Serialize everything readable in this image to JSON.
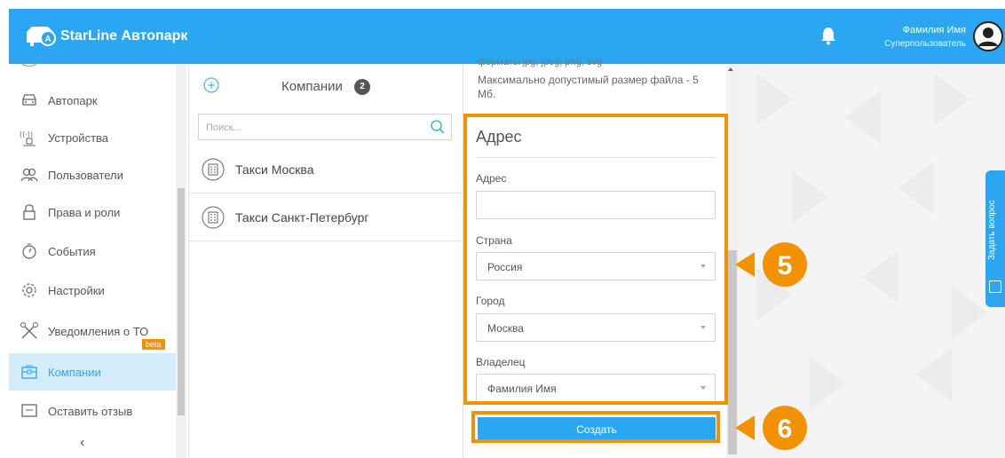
{
  "header": {
    "app_title": "StarLine Автопарк",
    "user_name": "Фамилия Имя",
    "user_role": "Суперпользователь"
  },
  "sidebar": {
    "items": [
      {
        "label": "Автопарк",
        "icon": "car-icon"
      },
      {
        "label": "Устройства",
        "icon": "device-icon"
      },
      {
        "label": "Пользователи",
        "icon": "users-icon"
      },
      {
        "label": "Права и роли",
        "icon": "lock-icon"
      },
      {
        "label": "События",
        "icon": "events-icon"
      },
      {
        "label": "Настройки",
        "icon": "gear-icon"
      },
      {
        "label": "Уведомления о ТО",
        "icon": "tools-icon"
      },
      {
        "label": "Компании",
        "icon": "company-icon"
      },
      {
        "label": "Оставить отзыв",
        "icon": "feedback-icon"
      }
    ],
    "beta_badge": "beta",
    "collapse_label": "‹"
  },
  "companies": {
    "title": "Компании",
    "count": "2",
    "search_placeholder": "Поиск...",
    "items": [
      {
        "label": "Такси Москва"
      },
      {
        "label": "Такси Санкт-Петербург"
      }
    ]
  },
  "form": {
    "file_hint_cut": "форматы jpg, jpeg, png, svg",
    "file_hint": "Максимально допустимый размер файла - 5 Мб.",
    "address_section_title": "Адрес",
    "address_label": "Адрес",
    "address_value": "",
    "country_label": "Страна",
    "country_value": "Россия",
    "city_label": "Город",
    "city_value": "Москва",
    "owner_label": "Владелец",
    "owner_value": "Фамилия Имя",
    "create_label": "Создать"
  },
  "markers": {
    "step_5": "5",
    "step_6": "6"
  },
  "ask_question": {
    "label": "Задать вопрос"
  },
  "colors": {
    "header": "#2aa7f0",
    "highlight": "#f39200",
    "active_bg": "#d5ecfb"
  }
}
